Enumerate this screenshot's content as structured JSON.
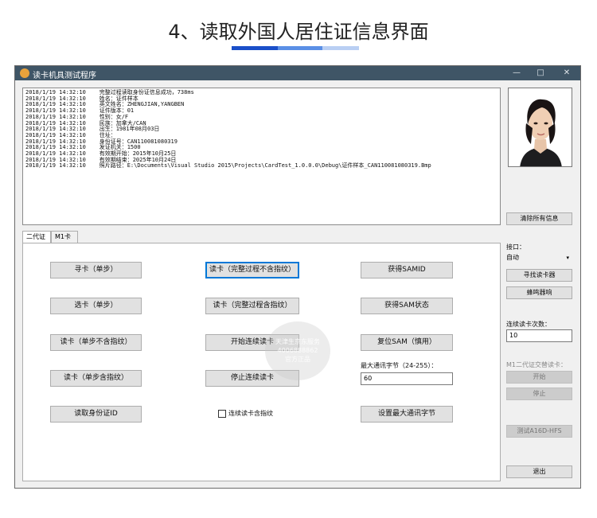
{
  "page": {
    "heading": "4、读取外国人居住证信息界面",
    "underline_colors": [
      "#1a4fc9",
      "#5a8fe6",
      "#b9cff3"
    ]
  },
  "window": {
    "title": "读卡机具测试程序",
    "min": "—",
    "max": "□",
    "close": "✕"
  },
  "log_lines": [
    "2018/1/19 14:32:10    完整过程读取身份证信息成功，738ms",
    "2018/1/19 14:32:10    姓名：证件样本",
    "2018/1/19 14:32:10    英文姓名：ZHENGJIAN,YANGBEN",
    "2018/1/19 14:32:10    证件版本：01",
    "2018/1/19 14:32:10    性别：女/F",
    "2018/1/19 14:32:10    民族：加拿大/CAN",
    "2018/1/19 14:32:10    出生：1981年08月03日",
    "2018/1/19 14:32:10    住址：",
    "2018/1/19 14:32:10    身份证号：CAN110081080319",
    "2018/1/19 14:32:10    发证机关：1500",
    "2018/1/19 14:32:10    有效期开始：2015年10月25日",
    "2018/1/19 14:32:10    有效期结束：2025年10月24日",
    "2018/1/19 14:32:10    照片路径：E:\\Documents\\Visual Studio 2015\\Projects\\CardTest_1.0.0.0\\Debug\\证件样本_CAN110081080319.Bmp"
  ],
  "right": {
    "clear_all": "清除所有信息",
    "port_label": "接口：",
    "port_value": "自动",
    "find_reader": "寻找读卡器",
    "buzzer": "蜂鸣器响",
    "continuous_count_label": "连续读卡次数：",
    "continuous_count_value": "10",
    "m1_label": "M1二代证交替读卡：",
    "start": "开始",
    "stop": "停止",
    "test_hfs": "测试A16D-HFS",
    "exit": "退出"
  },
  "tabs": [
    "二代证",
    "M1卡"
  ],
  "buttons": {
    "find_card_step": "寻卡（单步）",
    "select_card_step": "选卡（单步）",
    "read_step_no_fp": "读卡（单步不含指纹）",
    "read_step_fp": "读卡（单步含指纹）",
    "read_id": "读取身份证ID",
    "read_full_no_fp": "读卡（完整过程不含指纹）",
    "read_full_fp": "读卡（完整过程含指纹）",
    "start_continuous": "开始连续读卡",
    "stop_continuous": "停止连续读卡",
    "continuous_fp_label": "连续读卡含指纹",
    "get_samid": "获得SAMID",
    "get_sam_status": "获得SAM状态",
    "reset_sam": "复位SAM（慎用）",
    "max_bytes_label": "最大通讯字节（24-255）：",
    "max_bytes_value": "60",
    "set_max_bytes": "设置最大通讯字节"
  },
  "watermark": {
    "line1": "天津生京东服务",
    "line2": "4006888862",
    "line3": "官方正品"
  }
}
